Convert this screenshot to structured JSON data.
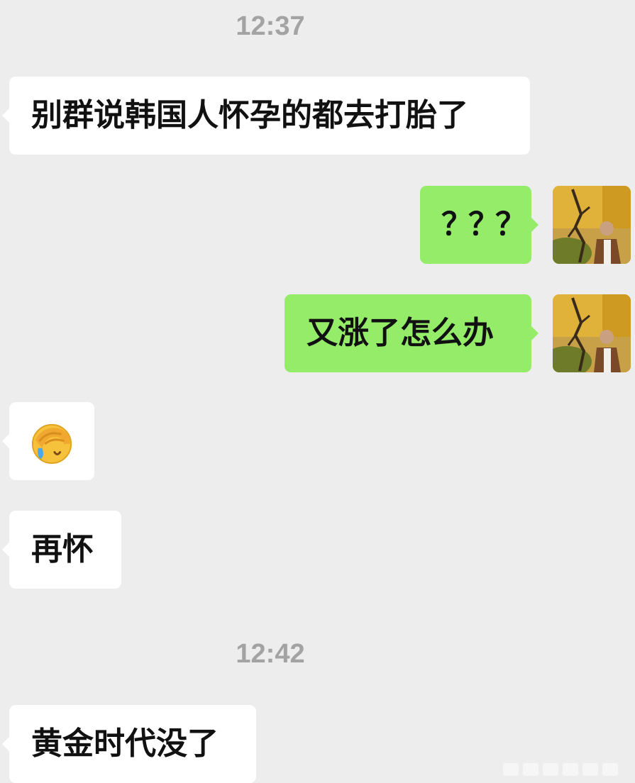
{
  "chat": {
    "timestamp_1": "12:37",
    "timestamp_2": "12:42",
    "messages": [
      {
        "sender": "contact",
        "text": "别群说韩国人怀孕的都去打胎了"
      },
      {
        "sender": "me",
        "text": "？？？"
      },
      {
        "sender": "me",
        "text": "又涨了怎么办"
      },
      {
        "sender": "contact",
        "emoji": "facepalm-crying-emoji"
      },
      {
        "sender": "contact",
        "text": "再怀"
      },
      {
        "sender": "contact",
        "text": "黄金时代没了"
      }
    ]
  },
  "colors": {
    "background": "#ededed",
    "incoming_bubble": "#ffffff",
    "outgoing_bubble": "#95ec69",
    "timestamp_text": "#a3a3a3",
    "message_text": "#111111"
  }
}
